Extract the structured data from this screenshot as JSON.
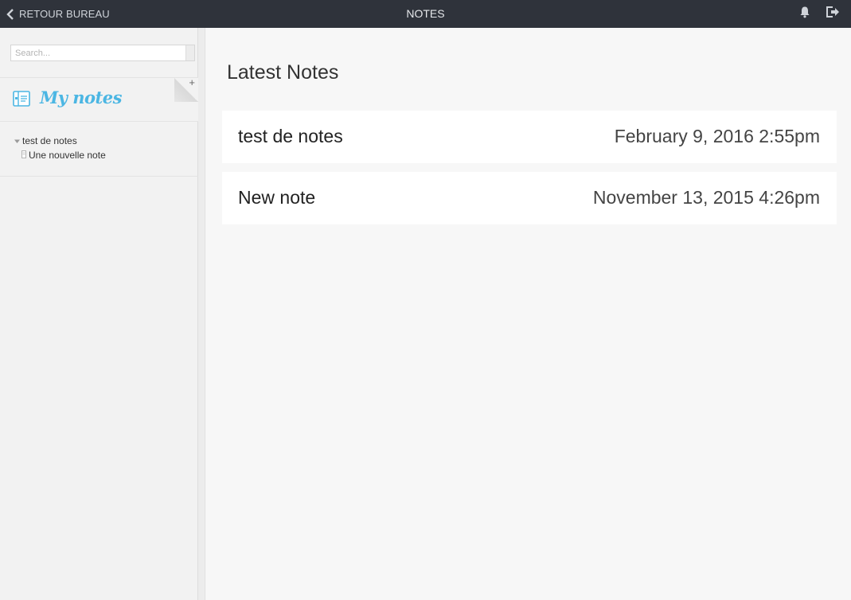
{
  "topbar": {
    "back_label": "RETOUR BUREAU",
    "title": "NOTES",
    "icons": [
      "bell-icon",
      "logout-icon"
    ]
  },
  "sidebar": {
    "search": {
      "placeholder": "Search...",
      "value": ""
    },
    "notebook_title": "My notes",
    "add_label": "+",
    "tree": {
      "folder": "test de notes",
      "items": [
        "Une nouvelle note"
      ]
    }
  },
  "main": {
    "title": "Latest Notes",
    "notes": [
      {
        "title": "test de notes",
        "date": "February 9, 2016 2:55pm"
      },
      {
        "title": "New note",
        "date": "November 13, 2015 4:26pm"
      }
    ]
  },
  "colors": {
    "topbar_bg": "#2f333b",
    "accent": "#4bb6e3",
    "sidebar_bg": "#f2f2f2",
    "card_bg": "#ffffff"
  }
}
